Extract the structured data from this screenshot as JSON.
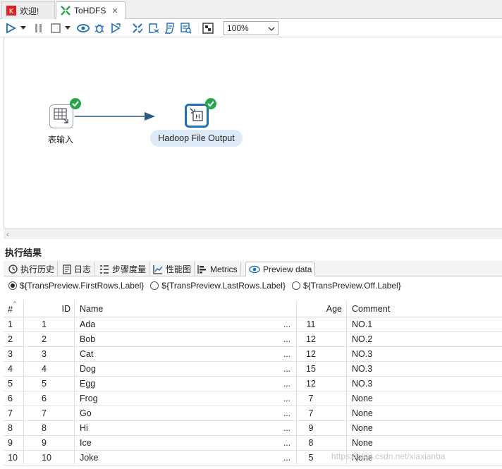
{
  "tabs": [
    {
      "label": "欢迎!",
      "icon": "welcome-icon"
    },
    {
      "label": "ToHDFS",
      "icon": "transformation-icon",
      "close": "✕"
    }
  ],
  "toolbar": {
    "zoom": "100%"
  },
  "canvas": {
    "steps": [
      {
        "label": "表输入",
        "icon": "table-input-icon",
        "status": "success"
      },
      {
        "label": "Hadoop File Output",
        "icon": "hadoop-file-output-icon",
        "status": "success"
      }
    ]
  },
  "results": {
    "title": "执行结果",
    "tabs": [
      {
        "label": "执行历史",
        "icon": "history-icon"
      },
      {
        "label": "日志",
        "icon": "log-icon"
      },
      {
        "label": "步骤度量",
        "icon": "step-metrics-icon"
      },
      {
        "label": "性能图",
        "icon": "performance-chart-icon"
      },
      {
        "label": "Metrics",
        "icon": "metrics-icon"
      },
      {
        "label": "Preview data",
        "icon": "eye-icon",
        "selected": true
      }
    ],
    "radios": [
      {
        "label": "${TransPreview.FirstRows.Label}",
        "checked": true
      },
      {
        "label": "${TransPreview.LastRows.Label}",
        "checked": false
      },
      {
        "label": "${TransPreview.Off.Label}",
        "checked": false
      }
    ],
    "columns": [
      "#",
      "ID",
      "Name",
      "Age",
      "Comment"
    ],
    "rows": [
      [
        "1",
        "1",
        "Ada",
        "11",
        "NO.1"
      ],
      [
        "2",
        "2",
        "Bob",
        "12",
        "NO.2"
      ],
      [
        "3",
        "3",
        "Cat",
        "12",
        "NO.3"
      ],
      [
        "4",
        "4",
        "Dog",
        "15",
        "NO.3"
      ],
      [
        "5",
        "5",
        "Egg",
        "12",
        "NO.3"
      ],
      [
        "6",
        "6",
        "Frog",
        "7",
        "None"
      ],
      [
        "7",
        "7",
        "Go",
        "7",
        "None"
      ],
      [
        "8",
        "8",
        "Hi",
        "9",
        "None"
      ],
      [
        "9",
        "9",
        "Ice",
        "8",
        "None"
      ],
      [
        "10",
        "10",
        "Joke",
        "5",
        "None"
      ]
    ],
    "truncation_marker": "..."
  },
  "watermark": "https://blog.csdn.net/xiaxianba",
  "colors": {
    "accent": "#1f6fb5",
    "success": "#2aa44a",
    "label_bg": "#dce9f6"
  }
}
